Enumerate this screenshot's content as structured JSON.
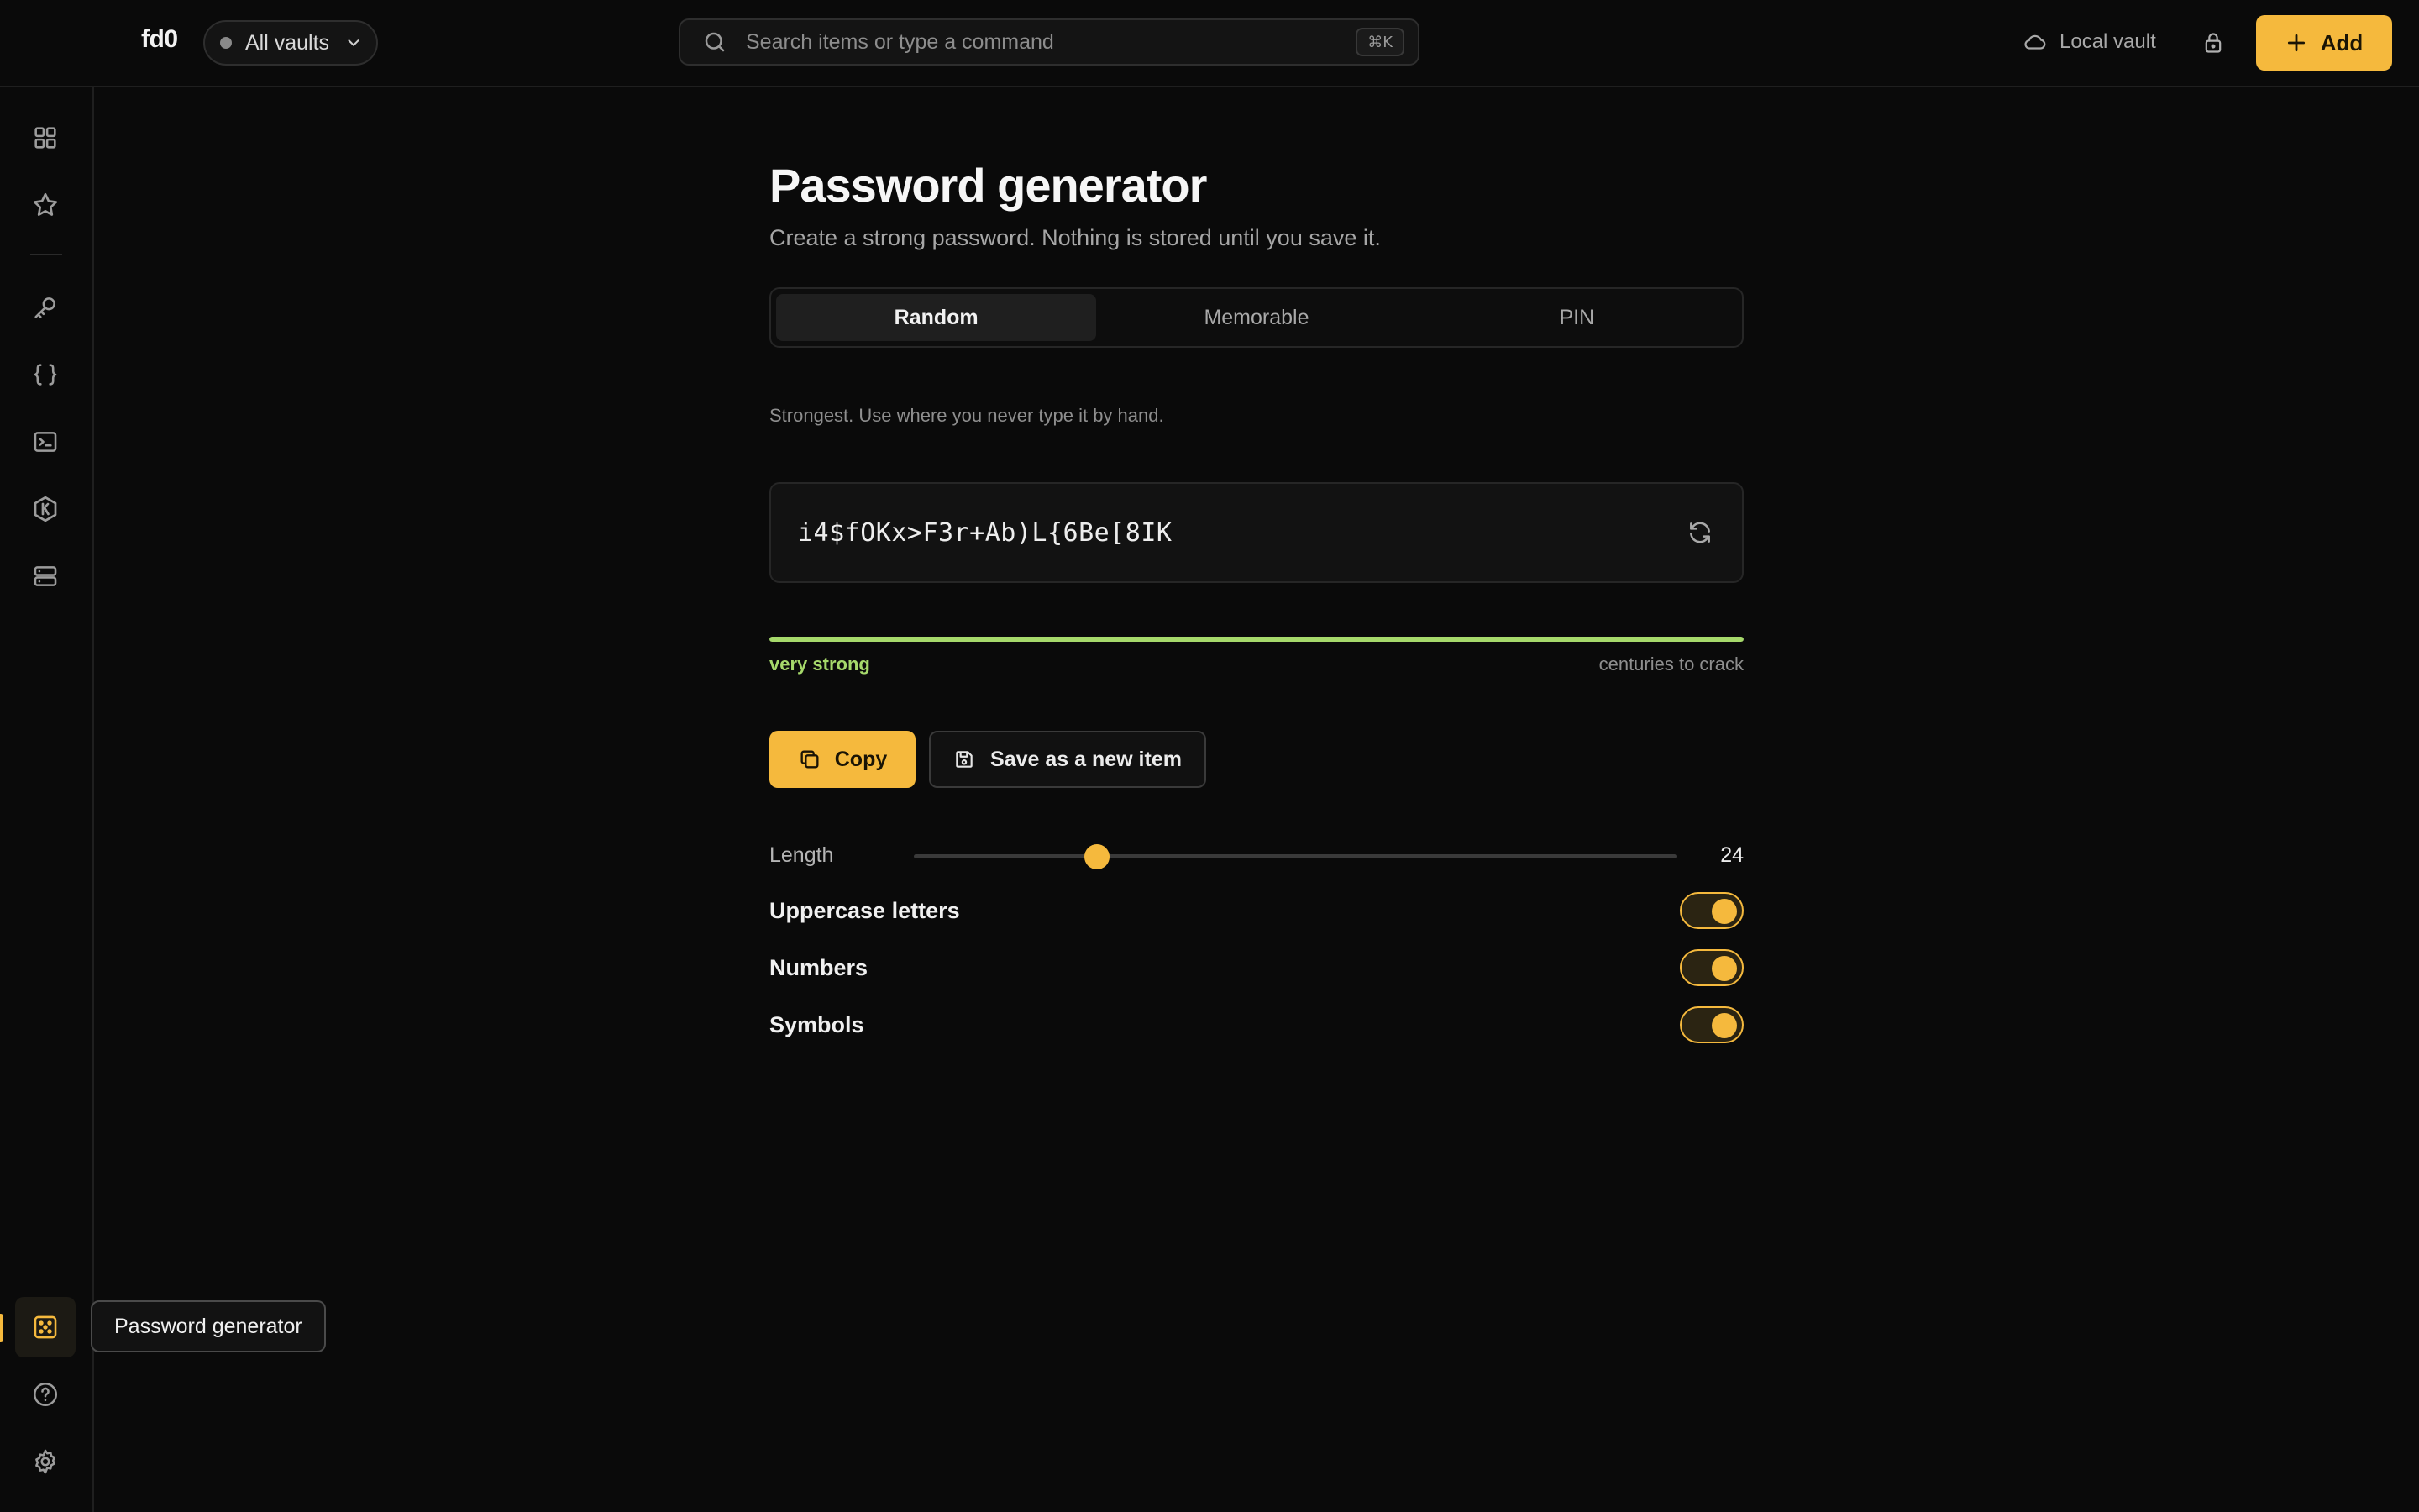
{
  "header": {
    "brand": "fd0",
    "vault_selector": "All vaults",
    "search_placeholder": "Search items or type a command",
    "search_shortcut": "⌘K",
    "storage_status": "Local vault",
    "add_label": "Add"
  },
  "sidebar": {
    "items": [
      {
        "name": "all-items",
        "icon": "grid-icon"
      },
      {
        "name": "favorites",
        "icon": "star-icon"
      },
      {
        "name": "logins",
        "icon": "key-icon"
      },
      {
        "name": "snippets",
        "icon": "braces-icon"
      },
      {
        "name": "terminal",
        "icon": "terminal-icon"
      },
      {
        "name": "kubernetes",
        "icon": "hexagon-k-icon"
      },
      {
        "name": "servers",
        "icon": "server-icon"
      },
      {
        "name": "password-generator",
        "icon": "dice-icon",
        "active": true
      },
      {
        "name": "help",
        "icon": "help-circle-icon"
      },
      {
        "name": "settings",
        "icon": "gear-icon"
      }
    ],
    "tooltip": "Password generator"
  },
  "main": {
    "title": "Password generator",
    "subtitle": "Create a strong password. Nothing is stored until you save it.",
    "modes": [
      {
        "label": "Random",
        "selected": true
      },
      {
        "label": "Memorable",
        "selected": false
      },
      {
        "label": "PIN",
        "selected": false
      }
    ],
    "mode_description": "Strongest. Use where you never type it by hand.",
    "password": "i4$fOKx>F3r+Ab)L{6Be[8IK",
    "strength": {
      "label": "very strong",
      "crack_time": "centuries to crack",
      "fraction": 1.0,
      "color": "#a6d96b"
    },
    "copy_label": "Copy",
    "save_label": "Save as a new item",
    "length": {
      "label": "Length",
      "value": "24",
      "fraction": 0.24
    },
    "options": [
      {
        "label": "Uppercase letters",
        "enabled": true
      },
      {
        "label": "Numbers",
        "enabled": true
      },
      {
        "label": "Symbols",
        "enabled": true
      }
    ]
  },
  "colors": {
    "accent": "#f5b93d",
    "background": "#0a0a0a",
    "strength_good": "#a6d96b"
  }
}
